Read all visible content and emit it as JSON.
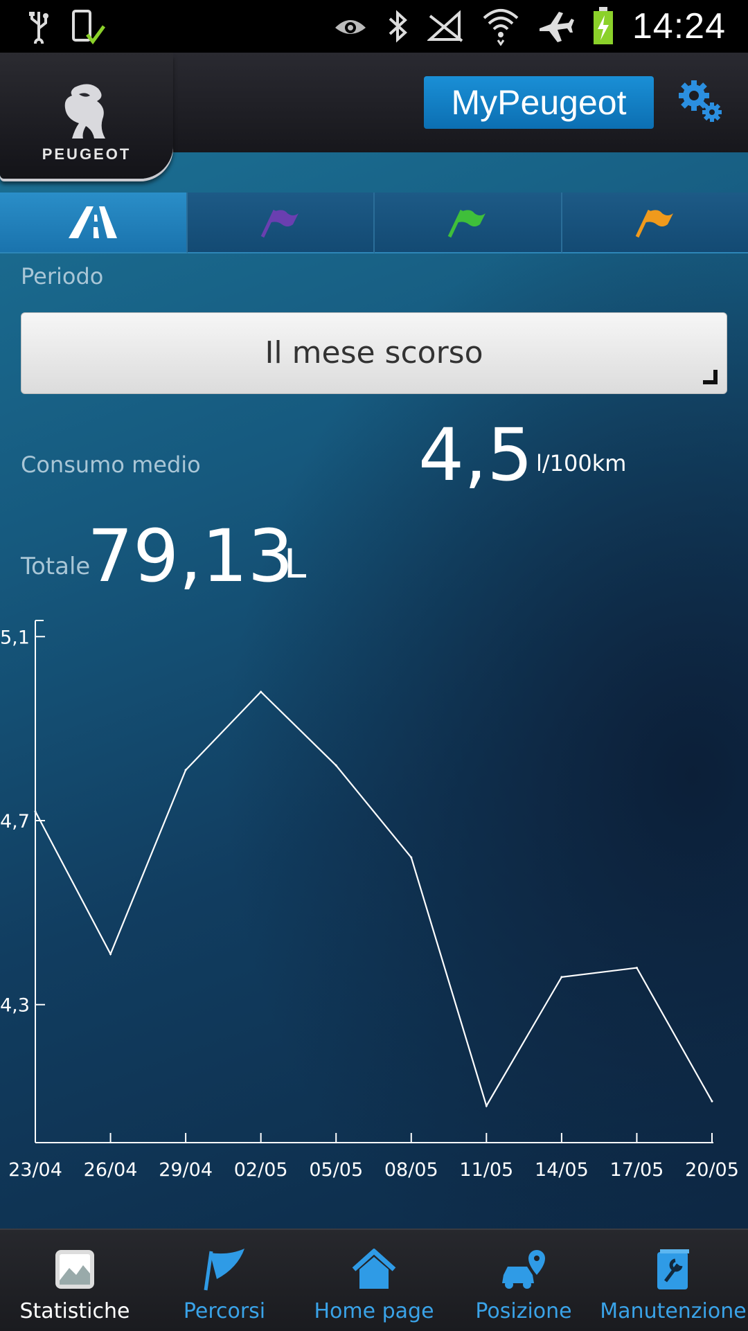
{
  "status_bar": {
    "time": "14:24",
    "left_icons": [
      "usb-icon",
      "phone-check-icon"
    ],
    "right_icons": [
      "eye-icon",
      "bluetooth-icon",
      "no-signal-icon",
      "wifi-icon",
      "airplane-icon",
      "battery-charging-icon"
    ]
  },
  "header": {
    "brand": "PEUGEOT",
    "app_button_label": "MyPeugeot",
    "settings_icon": "gear-icon"
  },
  "tabs": [
    {
      "icon": "road-icon",
      "active": true
    },
    {
      "icon": "flag-purple-icon",
      "color": "#6a3fb0"
    },
    {
      "icon": "flag-green-icon",
      "color": "#3fbf3a"
    },
    {
      "icon": "flag-orange-icon",
      "color": "#f09a1c"
    }
  ],
  "period": {
    "label": "Periodo",
    "selected": "Il mese scorso"
  },
  "consumption": {
    "label": "Consumo medio",
    "value": "4,5",
    "unit": "l/100km"
  },
  "total": {
    "label": "Totale",
    "value": "79,13",
    "unit": "L"
  },
  "chart_data": {
    "type": "line",
    "x": [
      "23/04",
      "26/04",
      "29/04",
      "02/05",
      "05/05",
      "08/05",
      "11/05",
      "14/05",
      "17/05",
      "20/05"
    ],
    "series": [
      {
        "values": [
          4.72,
          4.41,
          4.81,
          4.98,
          4.82,
          4.62,
          4.08,
          4.36,
          4.38,
          4.09
        ]
      }
    ],
    "y_ticks": [
      "5,1",
      "4,7",
      "4,3"
    ],
    "y_tick_values": [
      5.1,
      4.7,
      4.3
    ],
    "ylim": [
      4.0,
      5.12
    ],
    "grid": false,
    "line_color": "#ffffff"
  },
  "bottom_nav": [
    {
      "label": "Statistiche",
      "icon": "statistics-icon",
      "active": true
    },
    {
      "label": "Percorsi",
      "icon": "flag-icon"
    },
    {
      "label": "Home page",
      "icon": "home-icon"
    },
    {
      "label": "Posizione",
      "icon": "car-location-icon"
    },
    {
      "label": "Manutenzione",
      "icon": "wrench-book-icon"
    }
  ]
}
